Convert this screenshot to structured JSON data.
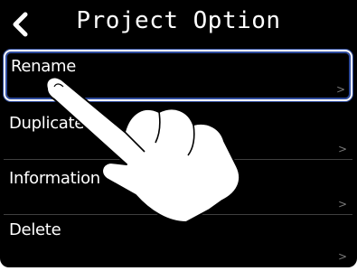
{
  "header": {
    "title": "Project Option",
    "back_icon": "chevron-left-icon"
  },
  "menu": {
    "items": [
      {
        "label": "Rename",
        "chevron": ">"
      },
      {
        "label": "Duplicate",
        "chevron": ">"
      },
      {
        "label": "Information",
        "chevron": ">"
      },
      {
        "label": "Delete",
        "chevron": ">"
      }
    ],
    "selected_index": 0
  },
  "overlay": {
    "icon": "pointing-hand-icon"
  },
  "colors": {
    "background": "#000000",
    "text": "#ffffff",
    "selection_outline": "#2d4a9c",
    "chevron": "#7a7a7a"
  }
}
